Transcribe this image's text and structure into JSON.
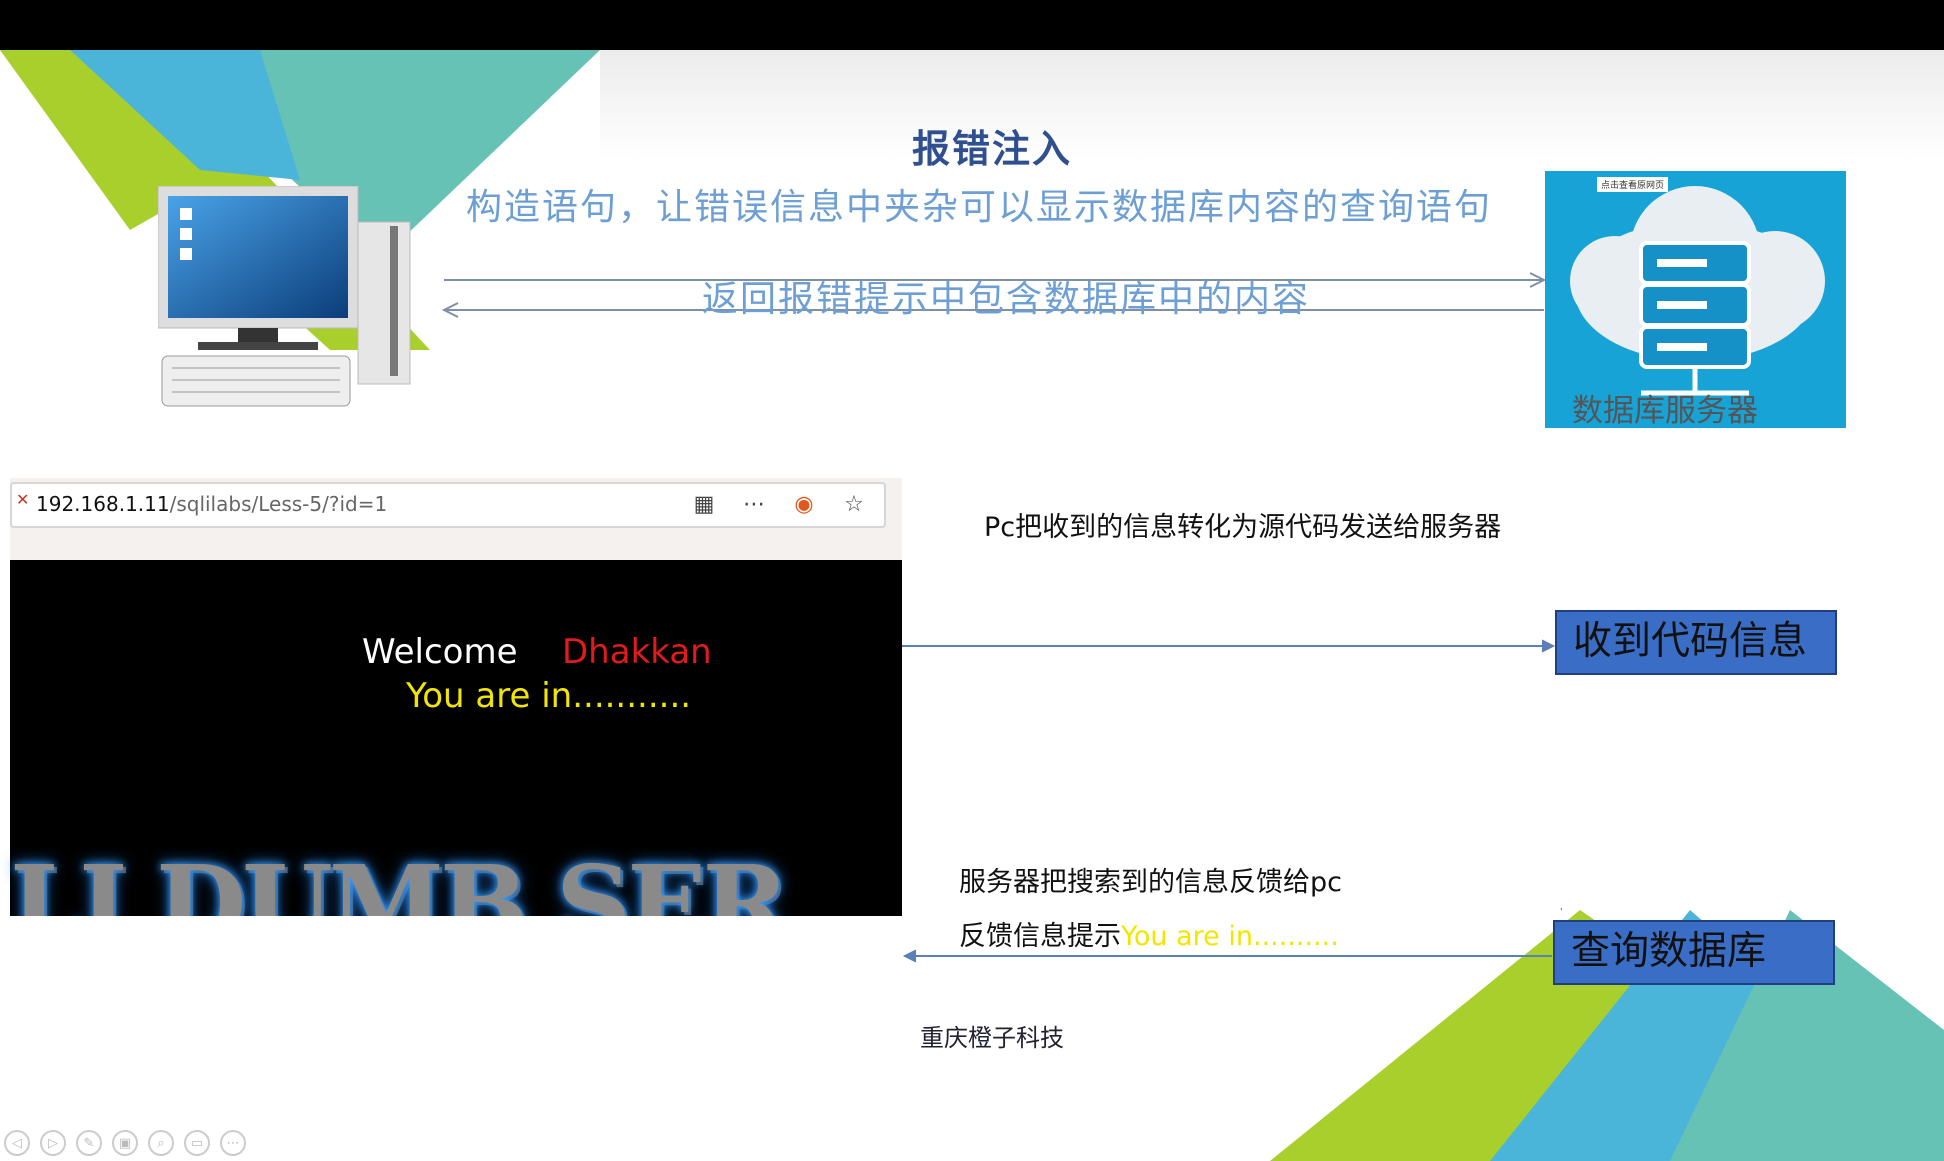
{
  "slide": {
    "title": "报错注入",
    "line1": "构造语句，让错误信息中夹杂可以显示数据库内容的查询语句",
    "line2": "返回报错提示中包含数据库中的内容",
    "db_server_label": "数据库服务器",
    "db_image_tag": "点击查看原网页",
    "pc_note": "Pc把收到的信息转化为源代码发送给服务器",
    "box_receive": "收到代码信息",
    "box_query": "查询数据库",
    "server_note": "服务器把搜索到的信息反馈给pc",
    "feedback_prefix": "反馈信息提示",
    "feedback_highlight": "You are in..........",
    "footer": "重庆橙子科技"
  },
  "browser": {
    "url_host": "192.168.1.11",
    "url_path": "/sqlilabs/Less-5/?id=1",
    "welcome": "Welcome",
    "name": "Dhakkan",
    "you_are_in": "You are in...........",
    "banner": "LI DUMB SER"
  },
  "colors": {
    "accent_blue": "#3a6ec6",
    "text_blue": "#6d9fd4",
    "title_blue": "#2f4f8f",
    "green": "#a9cf2c",
    "teal": "#66c2b4",
    "sky": "#4bb5d9"
  },
  "icons": [
    "qr-code-icon",
    "more-icon",
    "ubuntu-icon",
    "star-icon",
    "computer-icon",
    "cloud-server-icon"
  ]
}
